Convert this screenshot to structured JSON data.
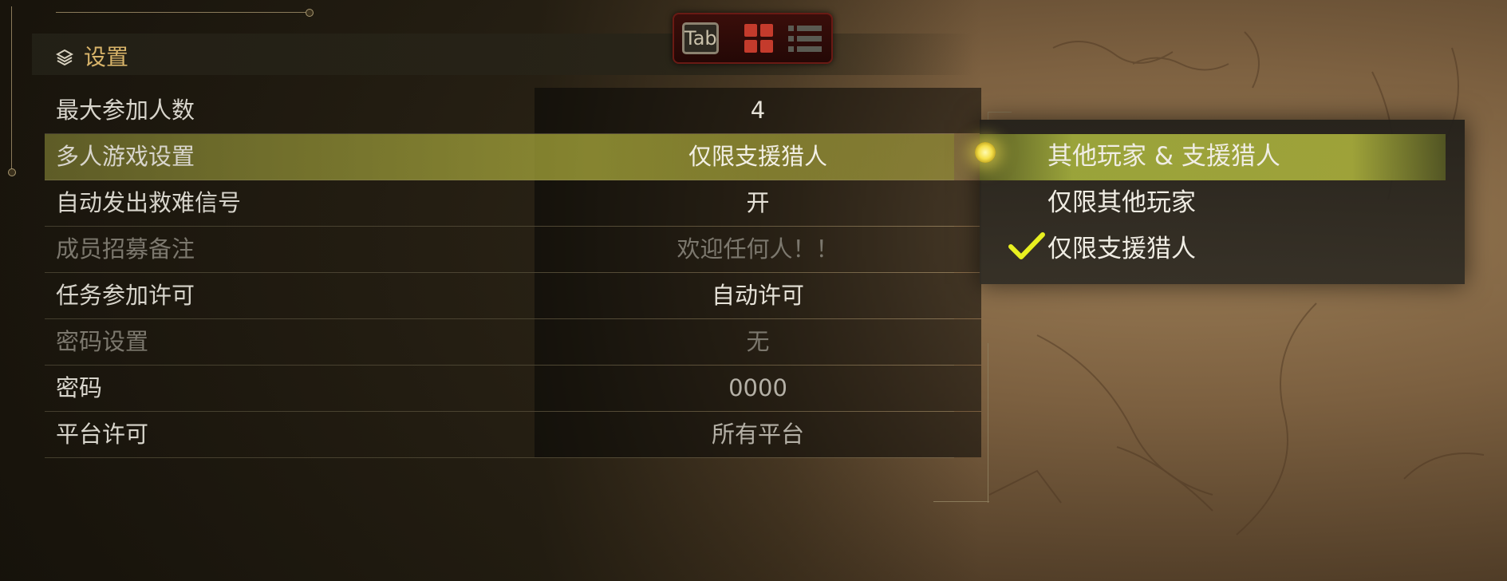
{
  "header": {
    "title": "设置"
  },
  "tab_switcher": {
    "key_label": "Tab"
  },
  "settings": [
    {
      "label": "最大参加人数",
      "value": "4",
      "state": "normal"
    },
    {
      "label": "多人游戏设置",
      "value": "仅限支援猎人",
      "state": "highlight"
    },
    {
      "label": "自动发出救难信号",
      "value": "开",
      "state": "normal"
    },
    {
      "label": "成员招募备注",
      "value": "欢迎任何人！！",
      "state": "dim"
    },
    {
      "label": "任务参加许可",
      "value": "自动许可",
      "state": "normal"
    },
    {
      "label": "密码设置",
      "value": "无",
      "state": "dim"
    },
    {
      "label": "密码",
      "value": "0000",
      "state": "mid"
    },
    {
      "label": "平台许可",
      "value": "所有平台",
      "state": "mid"
    }
  ],
  "dropdown": {
    "options": [
      {
        "label": "其他玩家 & 支援猎人",
        "cursor": true
      },
      {
        "label": "仅限其他玩家"
      },
      {
        "label": "仅限支援猎人",
        "checked": true
      }
    ]
  },
  "colors": {
    "highlight": "#a8aa3c",
    "header_text": "#d8b46a",
    "check": "#e8f020"
  },
  "icons": [
    "settings-icon",
    "tab-key-icon",
    "grid-view-icon",
    "list-view-icon",
    "cursor-icon",
    "checkmark-icon"
  ]
}
